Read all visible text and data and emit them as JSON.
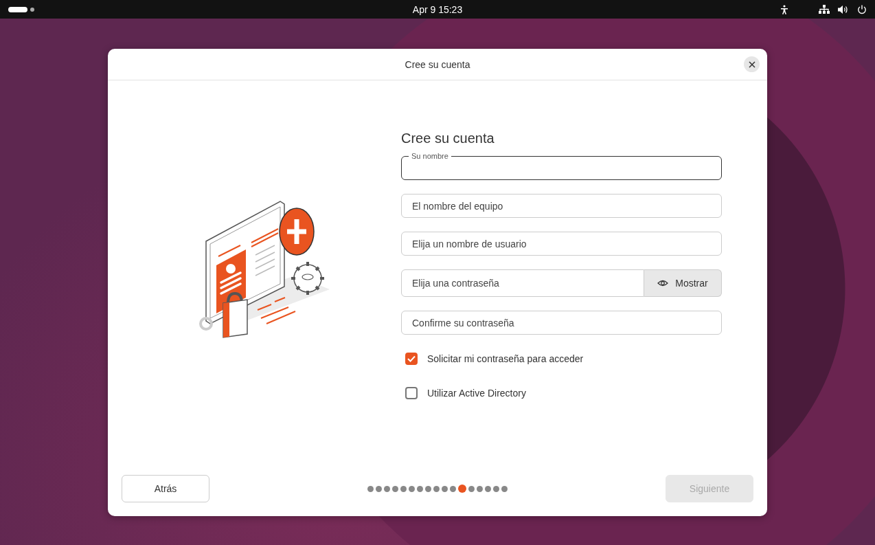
{
  "top_bar": {
    "clock": "Apr 9  15:23"
  },
  "window": {
    "title": "Cree su cuenta"
  },
  "form": {
    "heading": "Cree su cuenta",
    "fields": [
      {
        "placeholder": "Su nombre",
        "focused": true
      },
      {
        "placeholder": "El nombre del equipo",
        "focused": false
      },
      {
        "placeholder": "Elija un nombre de usuario",
        "focused": false
      },
      {
        "placeholder": "Elija una contraseña",
        "focused": false,
        "reveal_label": "Mostrar"
      },
      {
        "placeholder": "Confirme su contraseña",
        "focused": false
      }
    ],
    "options": [
      {
        "label": "Solicitar mi contraseña para acceder",
        "checked": true
      },
      {
        "label": "Utilizar Active Directory",
        "checked": false
      }
    ]
  },
  "footer": {
    "back": {
      "label": "Atrás",
      "disabled": false
    },
    "next": {
      "label": "Siguiente",
      "disabled": true
    },
    "steps": [
      {
        "selected": false
      },
      {
        "selected": false
      },
      {
        "selected": false
      },
      {
        "selected": false
      },
      {
        "selected": false
      },
      {
        "selected": false
      },
      {
        "selected": false
      },
      {
        "selected": false
      },
      {
        "selected": false
      },
      {
        "selected": false
      },
      {
        "selected": false
      },
      {
        "selected": true
      },
      {
        "selected": false
      },
      {
        "selected": false
      },
      {
        "selected": false
      },
      {
        "selected": false
      },
      {
        "selected": false
      }
    ]
  }
}
